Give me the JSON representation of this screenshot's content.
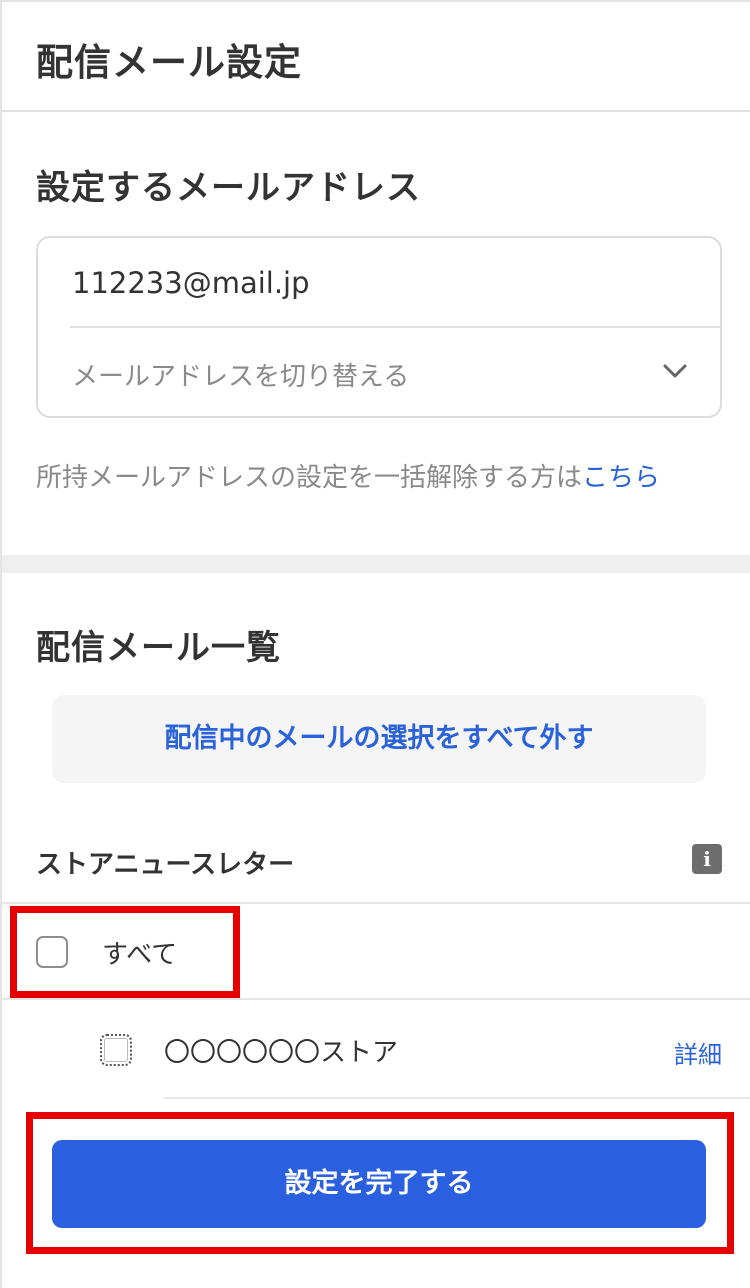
{
  "header": {
    "title": "配信メール設定"
  },
  "email_section": {
    "title": "設定するメールアドレス",
    "current_email": "112233@mail.jp",
    "switch_label": "メールアドレスを切り替える",
    "bulk_note": "所持メールアドレスの設定を一括解除する方は",
    "bulk_link": "こちら"
  },
  "list_section": {
    "title": "配信メール一覧",
    "unselect_all_label": "配信中のメールの選択をすべて外す",
    "group": {
      "title": "ストアニュースレター",
      "info_icon": "i",
      "select_all_label": "すべて",
      "items": [
        {
          "label": "〇〇〇〇〇〇ストア",
          "detail_label": "詳細"
        }
      ]
    }
  },
  "footer": {
    "submit_label": "設定を完了する"
  },
  "colors": {
    "accent": "#2a5fe0",
    "link": "#2a62d9",
    "highlight": "#e60000"
  }
}
